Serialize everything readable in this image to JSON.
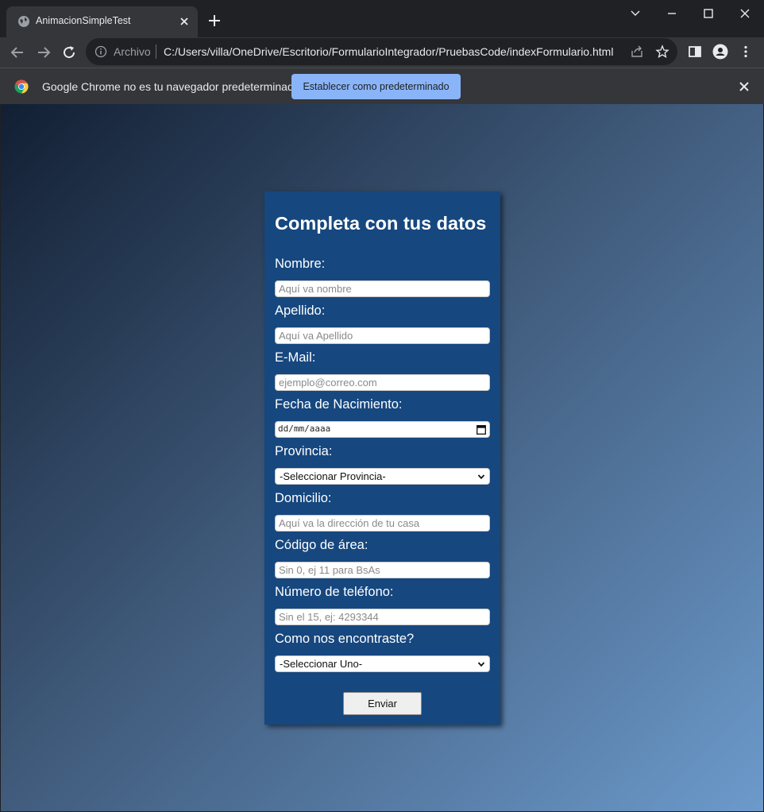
{
  "browser": {
    "tab_title": "AnimacionSimpleTest",
    "omnibox_scheme": "Archivo",
    "url": "C:/Users/villa/OneDrive/Escritorio/FormularioIntegrador/PruebasCode/indexFormulario.html",
    "infobar_text": "Google Chrome no es tu navegador predeterminado",
    "infobar_button": "Establecer como predeterminado"
  },
  "form": {
    "title": "Completa con tus datos",
    "fields": [
      {
        "label": "Nombre:",
        "placeholder": "Aquí va nombre"
      },
      {
        "label": "Apellido:",
        "placeholder": "Aquí va Apellido"
      },
      {
        "label": "E-Mail:",
        "placeholder": "ejemplo@correo.com"
      },
      {
        "label": "Fecha de Nacimiento:",
        "value": "dd/mm/aaaa"
      },
      {
        "label": "Provincia:",
        "value": "-Seleccionar Provincia-"
      },
      {
        "label": "Domicilio:",
        "placeholder": "Aquí va la dirección de tu casa"
      },
      {
        "label": "Código de área:",
        "placeholder": "Sin 0, ej 11 para BsAs"
      },
      {
        "label": "Número de teléfono:",
        "placeholder": "Sin el 15, ej: 4293344"
      },
      {
        "label": "Como nos encontraste?",
        "value": "-Seleccionar Uno-"
      }
    ],
    "submit_label": "Enviar"
  },
  "colors": {
    "page_gradient_start": "#121f33",
    "page_gradient_end": "#6c9acb",
    "card_background": "#16477f",
    "infobar_button": "#8ab4f8"
  },
  "icons": [
    "globe-icon",
    "close-icon",
    "plus-icon",
    "chevron-down-icon",
    "minimize-icon",
    "maximize-icon",
    "back-arrow-icon",
    "forward-arrow-icon",
    "reload-icon",
    "info-icon",
    "share-icon",
    "star-icon",
    "side-panel-icon",
    "profile-icon",
    "more-vert-icon",
    "chrome-logo-icon",
    "calendar-icon"
  ]
}
